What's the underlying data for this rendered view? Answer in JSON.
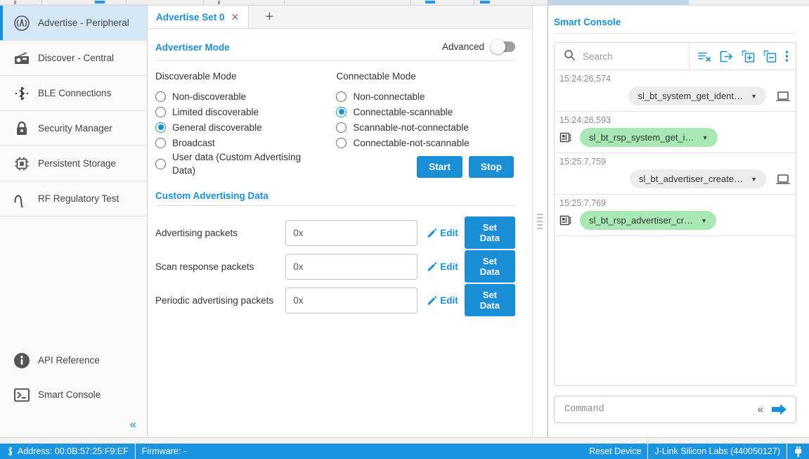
{
  "sidebar": {
    "items": [
      {
        "label": "Advertise - Peripheral",
        "icon": "broadcast-icon",
        "active": true
      },
      {
        "label": "Discover - Central",
        "icon": "radio-icon",
        "active": false
      },
      {
        "label": "BLE Connections",
        "icon": "bluetooth-icon",
        "active": false
      },
      {
        "label": "Security Manager",
        "icon": "lock-icon",
        "active": false
      },
      {
        "label": "Persistent Storage",
        "icon": "chip-icon",
        "active": false
      },
      {
        "label": "RF Regulatory Test",
        "icon": "waveform-icon",
        "active": false
      }
    ],
    "bottom_items": [
      {
        "label": "API Reference",
        "icon": "info-icon"
      },
      {
        "label": "Smart Console",
        "icon": "terminal-icon"
      }
    ],
    "collapse_glyph": "«"
  },
  "tabs": {
    "items": [
      {
        "label": "Advertise Set 0",
        "close_glyph": "✕"
      }
    ],
    "add_glyph": "+"
  },
  "advertiser": {
    "section_title": "Advertiser Mode",
    "advanced_label": "Advanced",
    "advanced_on": false,
    "discoverable": {
      "heading": "Discoverable Mode",
      "options": [
        {
          "label": "Non-discoverable",
          "selected": false
        },
        {
          "label": "Limited discoverable",
          "selected": false
        },
        {
          "label": "General discoverable",
          "selected": true
        },
        {
          "label": "Broadcast",
          "selected": false
        },
        {
          "label": "User data (Custom Advertising Data)",
          "selected": false
        }
      ]
    },
    "connectable": {
      "heading": "Connectable Mode",
      "options": [
        {
          "label": "Non-connectable",
          "selected": false
        },
        {
          "label": "Connectable-scannable",
          "selected": true
        },
        {
          "label": "Scannable-not-connectable",
          "selected": false
        },
        {
          "label": "Connectable-not-scannable",
          "selected": false
        }
      ]
    },
    "start_label": "Start",
    "stop_label": "Stop"
  },
  "custom_advertising": {
    "section_title": "Custom Advertising Data",
    "edit_label": "Edit",
    "set_data_label": "Set Data",
    "rows": [
      {
        "label": "Advertising packets",
        "value": "0x"
      },
      {
        "label": "Scan response packets",
        "value": "0x"
      },
      {
        "label": "Periodic advertising packets",
        "value": "0x"
      }
    ]
  },
  "console": {
    "title": "Smart Console",
    "search_placeholder": "Search",
    "toolbar_icons": [
      "clear-list-icon",
      "export-icon",
      "expand-all-icon",
      "collapse-all-icon",
      "more-options-icon"
    ],
    "entries": [
      {
        "time": "15:24:26,574",
        "text": "sl_bt_system_get_ident…",
        "kind": "request",
        "endpoint": "host"
      },
      {
        "time": "15:24:26,593",
        "text": "sl_bt_rsp_system_get_i…",
        "kind": "response",
        "endpoint": "device"
      },
      {
        "time": "15:25:7,759",
        "text": "sl_bt_advertiser_create…",
        "kind": "request",
        "endpoint": "host"
      },
      {
        "time": "15:25:7,769",
        "text": "sl_bt_rsp_advertiser_cr…",
        "kind": "response",
        "endpoint": "device"
      }
    ],
    "command_placeholder": "Command",
    "collapse_glyph": "«"
  },
  "statusbar": {
    "address": "Address: 00:0B:57:25:F9:EF",
    "firmware": "Firmware: -",
    "reset_device": "Reset Device",
    "adapter": "J-Link Silicon Labs (440050127)"
  },
  "colors": {
    "accent": "#1b8fd6",
    "status_bar": "#1b95e0",
    "response_pill": "#a8e8b4",
    "request_pill": "#ececec",
    "sidebar_active": "#d3e7f7"
  }
}
